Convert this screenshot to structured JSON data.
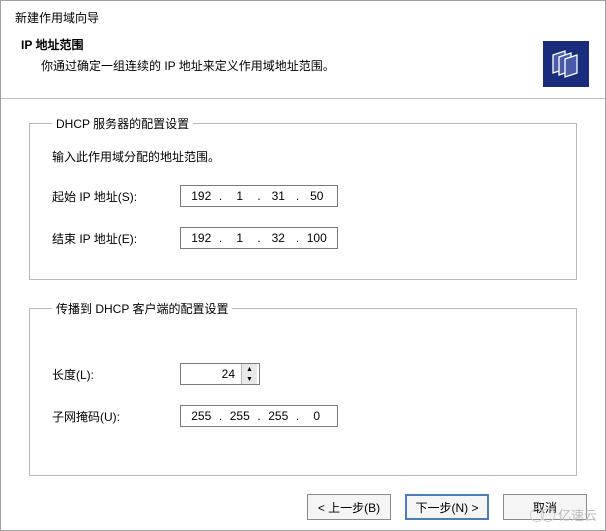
{
  "wizard_title": "新建作用域向导",
  "heading": "IP 地址范围",
  "description": "你通过确定一组连续的 IP 地址来定义作用域地址范围。",
  "group_server": {
    "legend": "DHCP 服务器的配置设置",
    "intro": "输入此作用域分配的地址范围。",
    "start": {
      "label": "起始 IP 地址(S):",
      "o1": "192",
      "o2": "1",
      "o3": "31",
      "o4": "50"
    },
    "end": {
      "label": "结束 IP 地址(E):",
      "o1": "192",
      "o2": "1",
      "o3": "32",
      "o4": "100"
    }
  },
  "group_client": {
    "legend": "传播到 DHCP 客户端的配置设置",
    "length": {
      "label": "长度(L):",
      "value": "24"
    },
    "mask": {
      "label": "子网掩码(U):",
      "o1": "255",
      "o2": "255",
      "o3": "255",
      "o4": "0"
    }
  },
  "buttons": {
    "back": "< 上一步(B)",
    "next": "下一步(N) >",
    "cancel": "取消"
  },
  "watermark": "亿速云"
}
